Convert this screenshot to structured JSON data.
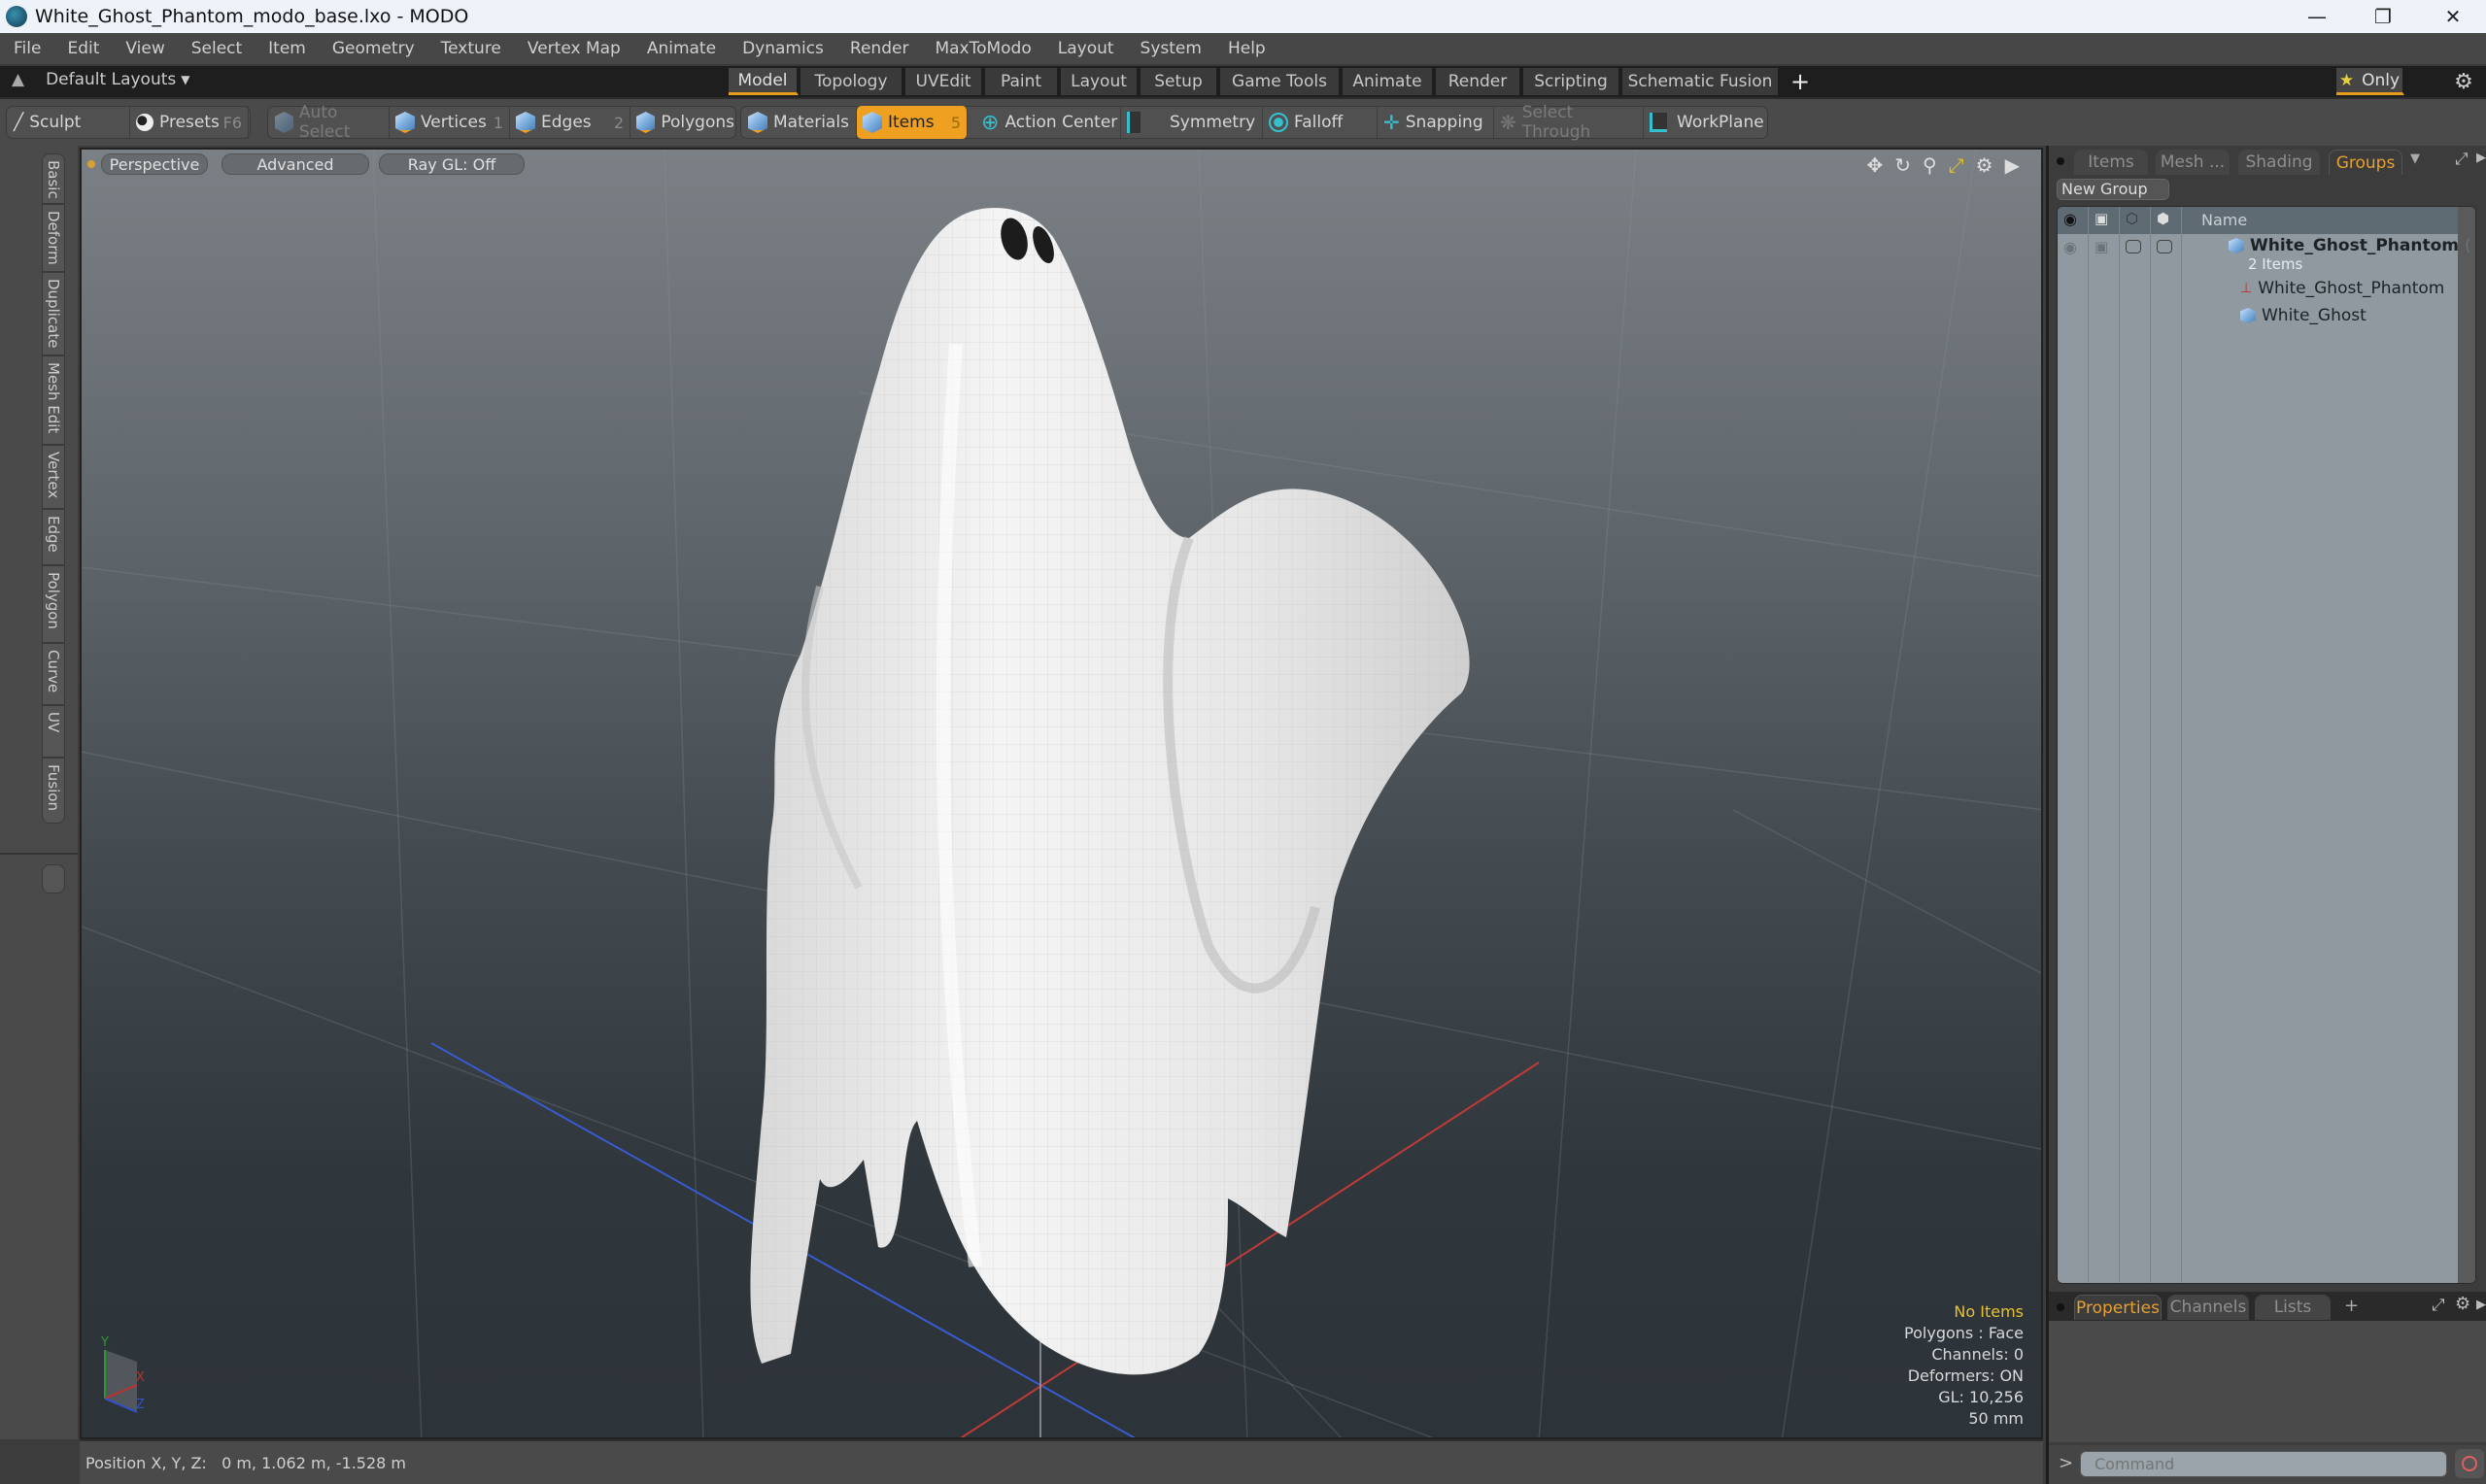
{
  "window": {
    "title": "White_Ghost_Phantom_modo_base.lxo - MODO",
    "controls": [
      "minimize",
      "restore",
      "close"
    ]
  },
  "menubar": {
    "items": [
      "File",
      "Edit",
      "View",
      "Select",
      "Item",
      "Geometry",
      "Texture",
      "Vertex Map",
      "Animate",
      "Dynamics",
      "Render",
      "MaxToModo",
      "Layout",
      "System",
      "Help"
    ]
  },
  "layoutbar": {
    "layout_selector": "Default Layouts",
    "tabs": [
      "Model",
      "Topology",
      "UVEdit",
      "Paint",
      "Layout",
      "Setup",
      "Game Tools",
      "Animate",
      "Render",
      "Scripting",
      "Schematic Fusion"
    ],
    "active_tab": "Model",
    "add_label": "+",
    "only_label": "Only"
  },
  "toolbar": {
    "sculpt": "Sculpt",
    "presets": "Presets",
    "presets_key": "F6",
    "auto_select": "Auto Select",
    "vertices": "Vertices",
    "vertices_key": "1",
    "edges": "Edges",
    "edges_key": "2",
    "polygons": "Polygons",
    "materials": "Materials",
    "items": "Items",
    "items_key": "5",
    "action_center": "Action Center",
    "symmetry": "Symmetry",
    "falloff": "Falloff",
    "snapping": "Snapping",
    "select_through": "Select Through",
    "workplane": "WorkPlane"
  },
  "side_tabs": [
    "Basic",
    "Deform",
    "Duplicate",
    "Mesh Edit",
    "Vertex",
    "Edge",
    "Polygon",
    "Curve",
    "UV",
    "Fusion"
  ],
  "viewport": {
    "view_mode": "Perspective",
    "shading": "Advanced",
    "raygl": "Ray GL: Off",
    "hud": {
      "selection": "No Items",
      "polygons": "Polygons : Face",
      "channels": "Channels: 0",
      "deformers": "Deformers: ON",
      "gl": "GL: 10,256",
      "focal": "50 mm"
    },
    "axis_labels": {
      "x": "X",
      "y": "Y",
      "z": "Z"
    }
  },
  "statusbar": {
    "position": "Position X, Y, Z:   0 m, 1.062 m, -1.528 m"
  },
  "right_panel": {
    "tabs": [
      "Items",
      "Mesh ...",
      "Shading",
      "Groups"
    ],
    "active_tab": "Groups",
    "new_group": "New Group",
    "name_header": "Name",
    "tree": {
      "group_name": "White_Ghost_Phantom",
      "group_suffix": "( ...",
      "group_count": "2 Items",
      "children": [
        {
          "name": "White_Ghost_Phantom",
          "icon": "locator-icon"
        },
        {
          "name": "White_Ghost",
          "icon": "mesh-icon"
        }
      ]
    },
    "bottom_tabs": [
      "Properties",
      "Channels",
      "Lists"
    ],
    "bottom_active": "Properties",
    "command_placeholder": "Command"
  },
  "colors": {
    "accent_orange": "#f0a020",
    "active_tab_text": "#e8a030",
    "hud_yellow": "#e8c030"
  }
}
